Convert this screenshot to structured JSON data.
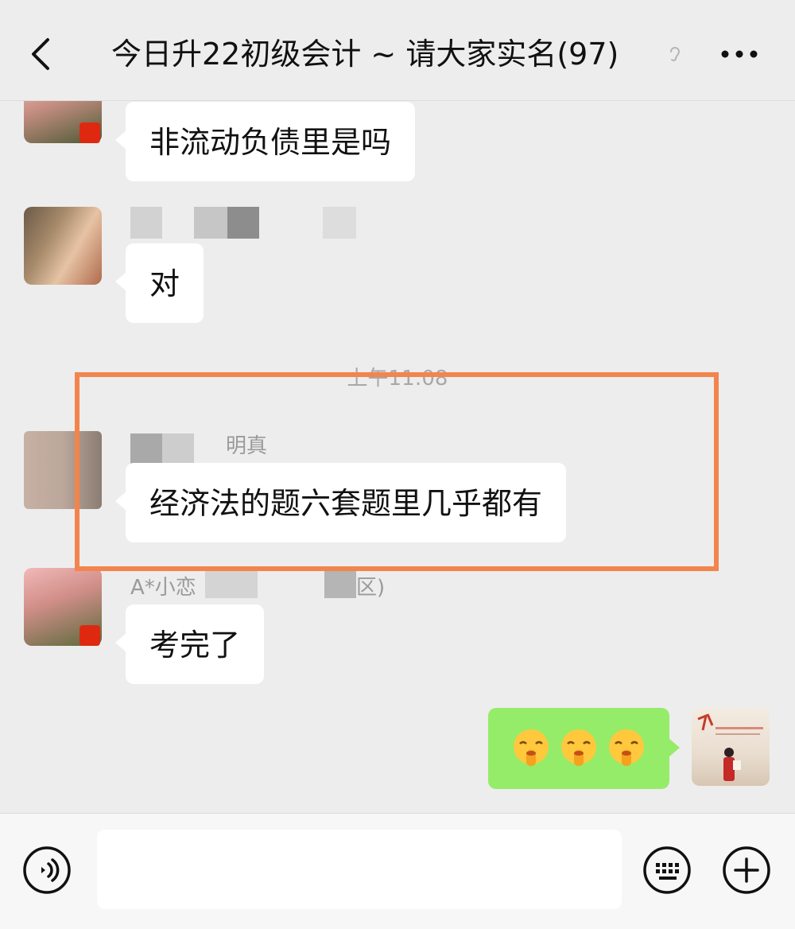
{
  "header": {
    "title": "今日升22初级会计 ~ 请大家实名(97)"
  },
  "messages": [
    {
      "text": "非流动负债里是吗"
    },
    {
      "text": "对"
    },
    {
      "timestamp": "上午11:08"
    },
    {
      "name_suffix": "明真",
      "text": "经济法的题六套题里几乎都有"
    },
    {
      "name_prefix": "A*小恋",
      "name_suffix": "区)",
      "text": "考完了"
    },
    {
      "emoji": "shushing-face",
      "count": 3,
      "from": "me"
    }
  ],
  "colors": {
    "background": "#ededed",
    "bubble_other": "#ffffff",
    "bubble_me": "#95ec69",
    "highlight": "#f2854d"
  }
}
